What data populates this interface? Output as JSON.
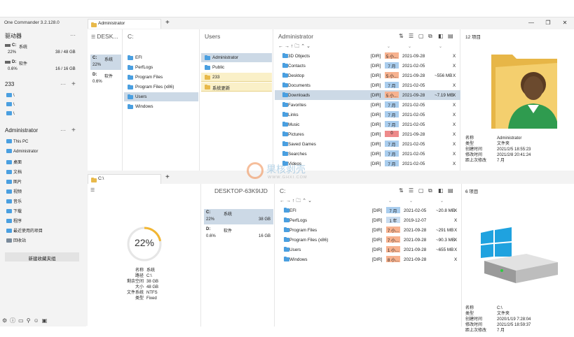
{
  "app": {
    "title": "One Commander 3.2.128.0"
  },
  "tabs": {
    "top": "Administrator",
    "bottom": "C:\\",
    "add": "+"
  },
  "window": {
    "min": "—",
    "max": "❐",
    "close": "✕"
  },
  "sidebar": {
    "drives_title": "驱动器",
    "more": "···",
    "drives": [
      {
        "letter": "C:",
        "name": "系统",
        "pct": "22%",
        "size": "38 / 48 GB"
      },
      {
        "letter": "D:",
        "name": "软件",
        "pct": "0.6%",
        "size": "16 / 16 GB"
      }
    ],
    "group233": {
      "title": "233",
      "items": [
        "\\",
        "\\",
        "\\"
      ]
    },
    "group_admin": {
      "title": "Administrator",
      "items": [
        "This PC",
        "Administrator",
        "桌面",
        "文档",
        "图片",
        "视频",
        "音乐",
        "下载",
        "程序",
        "最近使用的项目",
        "回收站"
      ]
    },
    "new_group_button": "新建收藏夹组",
    "add": "+",
    "bottom_icons": [
      "gear",
      "info",
      "screen",
      "search",
      "user",
      "window"
    ]
  },
  "top": {
    "col1": {
      "header": "DESK...",
      "drives": [
        {
          "letter": "C:",
          "name": "系统",
          "pct": "22%"
        },
        {
          "letter": "D:",
          "name": "软件",
          "pct": "0.6%"
        }
      ]
    },
    "col2": {
      "header": "C:",
      "items": [
        "EFI",
        "PerfLogs",
        "Program Files",
        "Program Files (x86)",
        "Users",
        "Windows"
      ],
      "selected": 4
    },
    "col3": {
      "header": "Users",
      "items": [
        "Administrator",
        "Public",
        "233",
        "系统更新"
      ],
      "selected": 0
    },
    "main": {
      "header": "Administrator",
      "nav": "← → ↑ 🗀 ⌃ ⌄",
      "files": [
        {
          "name": "3D Objects",
          "dir": "[DIR]",
          "age": "5 小...",
          "age_color": "#f7b28f",
          "date": "2021-09-28",
          "size": "",
          "x": "X"
        },
        {
          "name": "Contacts",
          "dir": "[DIR]",
          "age": "7 月",
          "age_color": "#a9cdee",
          "date": "2021-02-05",
          "size": "",
          "x": "X"
        },
        {
          "name": "Desktop",
          "dir": "[DIR]",
          "age": "5 小...",
          "age_color": "#f7b28f",
          "date": "2021-09-28",
          "size": "~556 MB",
          "x": "X"
        },
        {
          "name": "Documents",
          "dir": "[DIR]",
          "age": "7 月",
          "age_color": "#a9cdee",
          "date": "2021-02-05",
          "size": "",
          "x": "X"
        },
        {
          "name": "Downloads",
          "dir": "[DIR]",
          "age": "5 小...",
          "age_color": "#f7b28f",
          "date": "2021-09-28",
          "size": "~7.19 MB",
          "x": "X"
        },
        {
          "name": "Favorites",
          "dir": "[DIR]",
          "age": "7 月",
          "age_color": "#a9cdee",
          "date": "2021-02-05",
          "size": "",
          "x": "X"
        },
        {
          "name": "Links",
          "dir": "[DIR]",
          "age": "7 月",
          "age_color": "#a9cdee",
          "date": "2021-02-05",
          "size": "",
          "x": "X"
        },
        {
          "name": "Music",
          "dir": "[DIR]",
          "age": "7 月",
          "age_color": "#a9cdee",
          "date": "2021-02-05",
          "size": "",
          "x": "X"
        },
        {
          "name": "Pictures",
          "dir": "[DIR]",
          "age": "0",
          "age_color": "#ee8a8a",
          "date": "2021-09-28",
          "size": "",
          "x": "X"
        },
        {
          "name": "Saved Games",
          "dir": "[DIR]",
          "age": "7 月",
          "age_color": "#a9cdee",
          "date": "2021-02-05",
          "size": "",
          "x": "X"
        },
        {
          "name": "Searches",
          "dir": "[DIR]",
          "age": "7 月",
          "age_color": "#a9cdee",
          "date": "2021-02-05",
          "size": "",
          "x": "X"
        },
        {
          "name": "Videos",
          "dir": "[DIR]",
          "age": "7 月",
          "age_color": "#a9cdee",
          "date": "2021-02-05",
          "size": "",
          "x": "X"
        }
      ],
      "selected": 4
    },
    "info": {
      "count": "12 项目",
      "props": [
        {
          "k": "名称",
          "v": "Administrator"
        },
        {
          "k": "类型",
          "v": "文件夹"
        },
        {
          "k": "创建时间",
          "v": "2021/2/5 18:55:23"
        },
        {
          "k": "修改时间",
          "v": "2021/2/8 20:41:24"
        },
        {
          "k": "距上次修改",
          "v": "7 月"
        }
      ]
    }
  },
  "bottom": {
    "drive": {
      "pct": "22%",
      "props": [
        {
          "k": "名称",
          "v": "系统"
        },
        {
          "k": "路径",
          "v": "C:\\"
        },
        {
          "k": "剩余空间",
          "v": "38 GB"
        },
        {
          "k": "大小",
          "v": "48 GB"
        },
        {
          "k": "文件系统",
          "v": "NTFS"
        },
        {
          "k": "类型",
          "v": "Fixed"
        }
      ]
    },
    "col2": {
      "header": "DESKTOP-63K9IJD",
      "drives": [
        {
          "letter": "C:",
          "name": "系统",
          "pct": "22%",
          "size": "38 GB"
        },
        {
          "letter": "D:",
          "name": "软件",
          "pct": "0.6%",
          "size": "16 GB"
        }
      ]
    },
    "main": {
      "header": "C:",
      "nav": "← → ↑ 🗀 ⌃ ⌄",
      "files": [
        {
          "name": "EFI",
          "dir": "[DIR]",
          "age": "7 月",
          "age_color": "#a9cdee",
          "date": "2021-02-05",
          "size": "~20.8 MB",
          "x": "X"
        },
        {
          "name": "PerfLogs",
          "dir": "[DIR]",
          "age": "1 年",
          "age_color": "#c8dcf0",
          "date": "2019-12-07",
          "size": "",
          "x": "X"
        },
        {
          "name": "Program Files",
          "dir": "[DIR]",
          "age": "7 小...",
          "age_color": "#f7b28f",
          "date": "2021-09-28",
          "size": "~291 MB",
          "x": "X"
        },
        {
          "name": "Program Files (x86)",
          "dir": "[DIR]",
          "age": "7 小...",
          "age_color": "#f7b28f",
          "date": "2021-09-28",
          "size": "~90.3 MB",
          "x": "X"
        },
        {
          "name": "Users",
          "dir": "[DIR]",
          "age": "1 小...",
          "age_color": "#f7b28f",
          "date": "2021-09-28",
          "size": "~655 MB",
          "x": "X"
        },
        {
          "name": "Windows",
          "dir": "[DIR]",
          "age": "8 小...",
          "age_color": "#f7b28f",
          "date": "2021-09-28",
          "size": "",
          "x": "X"
        }
      ]
    },
    "info": {
      "count": "6 项目",
      "props": [
        {
          "k": "名称",
          "v": "C:\\"
        },
        {
          "k": "类型",
          "v": "文件夹"
        },
        {
          "k": "创建时间",
          "v": "2020/1/19 7:28:04"
        },
        {
          "k": "修改时间",
          "v": "2021/2/5 18:59:37"
        },
        {
          "k": "距上次修改",
          "v": "7 月"
        }
      ]
    }
  },
  "toolbar_icons": [
    "sort-icon",
    "filter-icon",
    "copy-icon",
    "move-icon",
    "paste-icon",
    "delete-icon"
  ],
  "toolbar_glyphs": [
    "⇅",
    "☰",
    "▢",
    "⧉",
    "◧",
    "▤"
  ],
  "watermark": {
    "main": "果核剥壳",
    "sub": "WWW.GHXI.COM"
  }
}
